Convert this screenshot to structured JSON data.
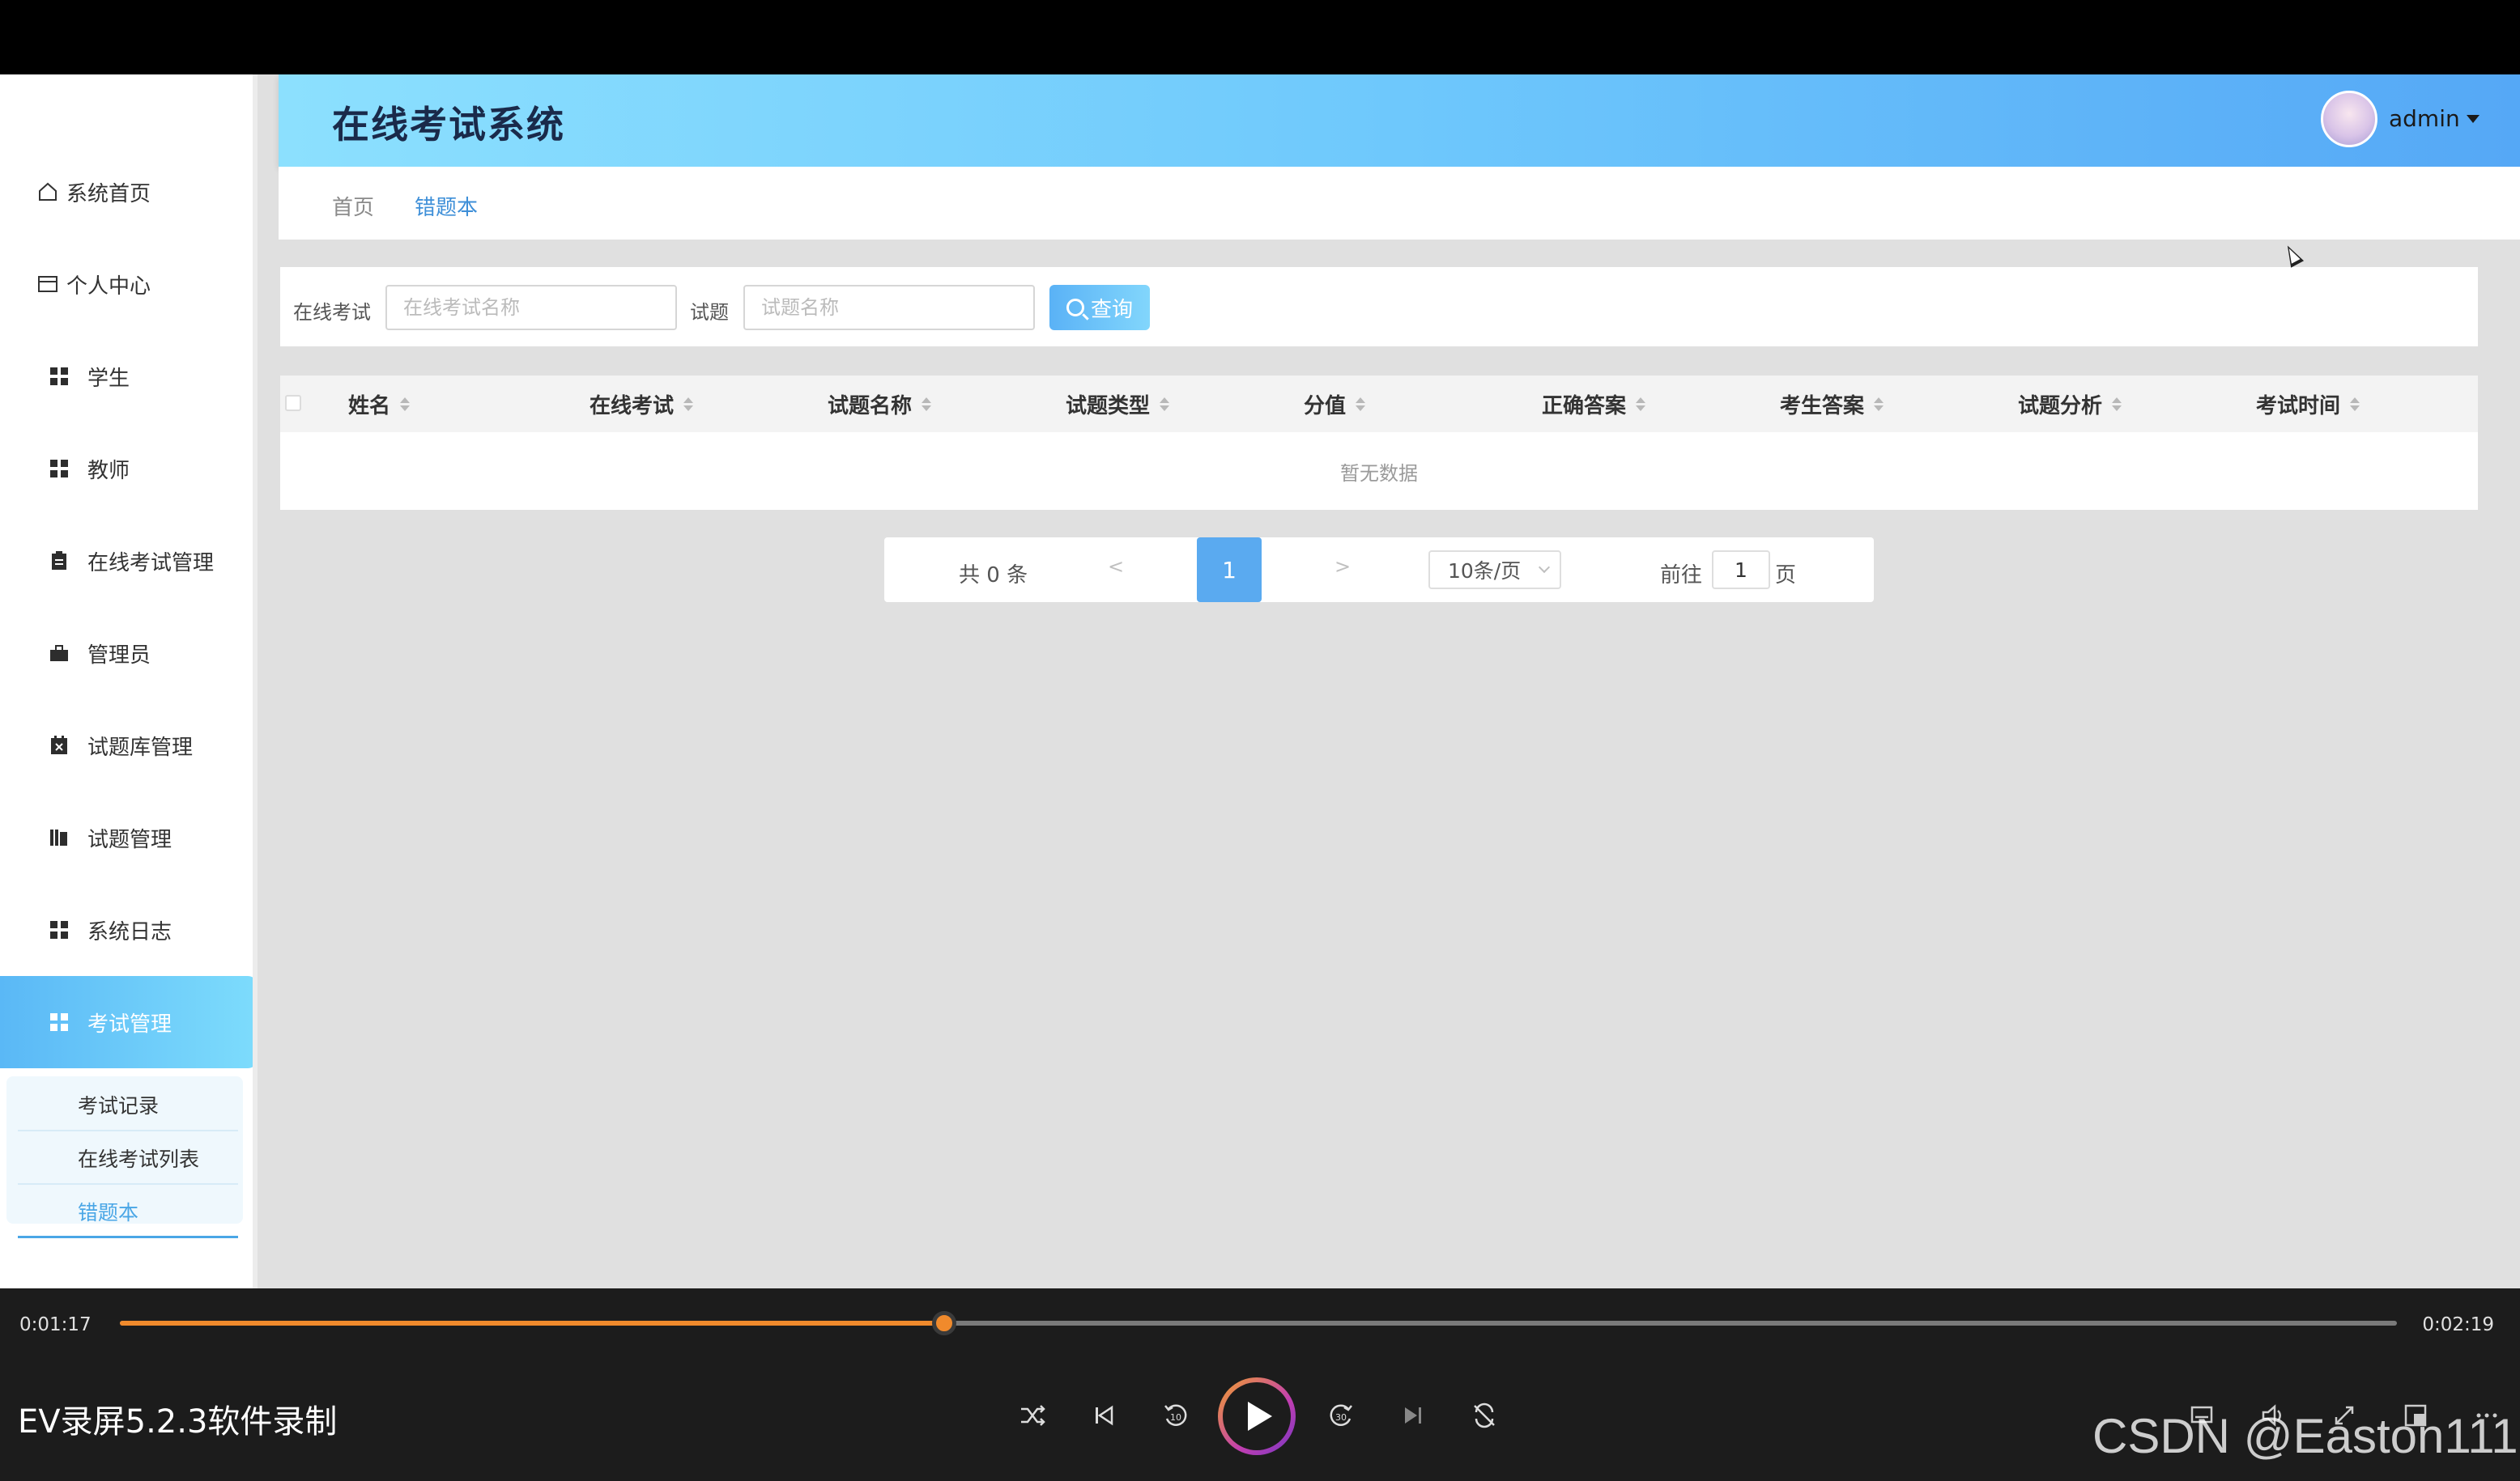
{
  "app": {
    "title": "在线考试系统",
    "user": "admin"
  },
  "sidebar": {
    "items": [
      {
        "label": "系统首页",
        "icon": "home-icon"
      },
      {
        "label": "个人中心",
        "icon": "id-card-icon"
      },
      {
        "label": "学生",
        "icon": "grid-icon"
      },
      {
        "label": "教师",
        "icon": "grid-icon"
      },
      {
        "label": "在线考试管理",
        "icon": "clipboard-icon"
      },
      {
        "label": "管理员",
        "icon": "briefcase-icon"
      },
      {
        "label": "试题库管理",
        "icon": "calendar-x-icon"
      },
      {
        "label": "试题管理",
        "icon": "books-icon"
      },
      {
        "label": "系统日志",
        "icon": "grid-icon"
      },
      {
        "label": "考试管理",
        "icon": "grid-icon",
        "active": true
      }
    ],
    "submenu": [
      {
        "label": "考试记录"
      },
      {
        "label": "在线考试列表"
      },
      {
        "label": "错题本",
        "active": true
      }
    ]
  },
  "breadcrumb": {
    "home": "首页",
    "current": "错题本"
  },
  "search": {
    "exam_label": "在线考试",
    "exam_placeholder": "在线考试名称",
    "question_label": "试题",
    "question_placeholder": "试题名称",
    "button": "查询"
  },
  "table": {
    "columns": [
      "姓名",
      "在线考试",
      "试题名称",
      "试题类型",
      "分值",
      "正确答案",
      "考生答案",
      "试题分析",
      "考试时间"
    ],
    "empty_text": "暂无数据"
  },
  "pagination": {
    "total": "共 0 条",
    "prev": "<",
    "current_page": "1",
    "next": ">",
    "page_size": "10条/页",
    "goto_label": "前往",
    "goto_value": "1",
    "goto_unit": "页"
  },
  "player": {
    "current_time": "0:01:17",
    "total_time": "0:02:19",
    "progress": 0.362,
    "title": "EV录屏5.2.3软件录制",
    "watermark": "CSDN @Easton111"
  },
  "colors": {
    "accent": "#5aaaf0",
    "header_gradient_start": "#8ce0fe",
    "header_gradient_end": "#55a8f6",
    "progress": "#f08a2c"
  }
}
